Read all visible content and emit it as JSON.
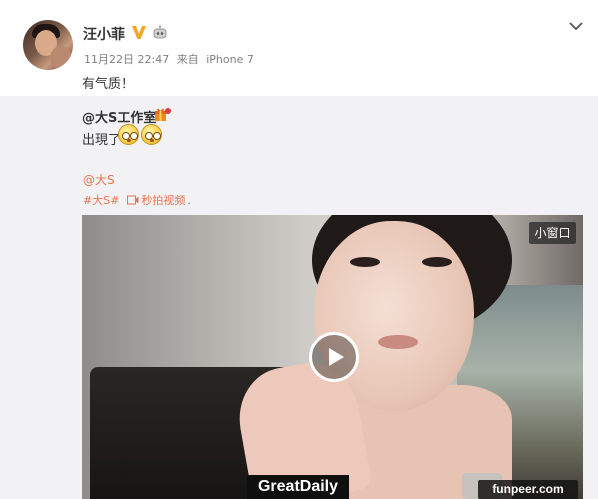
{
  "post": {
    "username": "汪小菲",
    "time": "11月22日 22:47",
    "source_prefix": "来自",
    "source_device": "iPhone 7",
    "text": "有气质！"
  },
  "repost": {
    "author": "@大S工作室",
    "text": "出現了",
    "mention": "@大S",
    "tag": "#大S#",
    "video_link": "秒拍视频",
    "trailing": "."
  },
  "video": {
    "mini_window_label": "小窗口"
  },
  "watermarks": {
    "left": "GreatDaily",
    "right": "funpeer.com"
  },
  "colors": {
    "link": "#eb7350",
    "verified": "#f5a623",
    "repost_bg": "#f2f2f5"
  },
  "icons": [
    "verified-v-icon",
    "robot-icon",
    "chevron-down-icon",
    "gift-icon",
    "emoji-icon",
    "video-link-icon",
    "play-icon"
  ]
}
